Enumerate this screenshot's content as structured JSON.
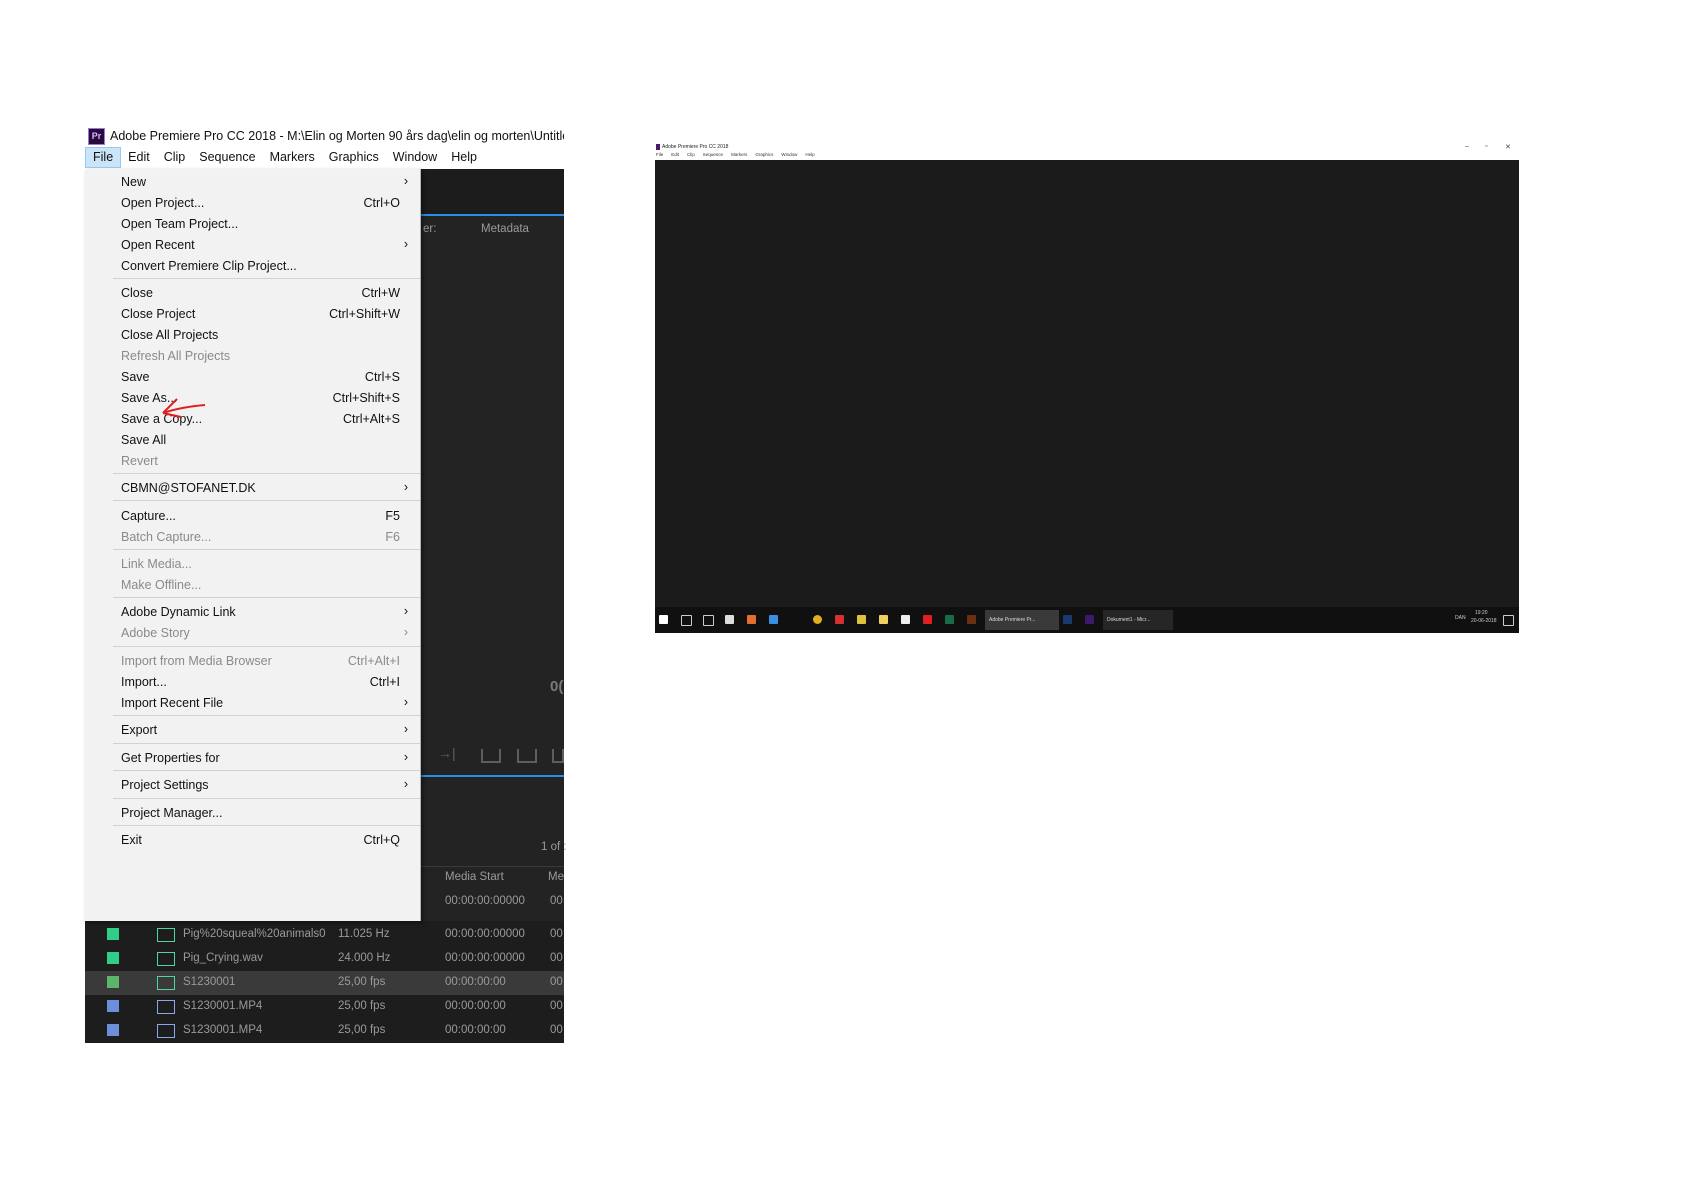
{
  "app": {
    "title": "Adobe Premiere Pro CC 2018 - M:\\Elin og Morten 90 års dag\\elin og morten\\Untitle",
    "logo": "Pr",
    "menubar": [
      "File",
      "Edit",
      "Clip",
      "Sequence",
      "Markers",
      "Graphics",
      "Window",
      "Help"
    ]
  },
  "file_menu": {
    "items": [
      {
        "label": "New",
        "shortcut": "",
        "submenu": true,
        "disabled": false
      },
      {
        "label": "Open Project...",
        "shortcut": "Ctrl+O",
        "submenu": false,
        "disabled": false
      },
      {
        "label": "Open Team Project...",
        "shortcut": "",
        "submenu": false,
        "disabled": false
      },
      {
        "label": "Open Recent",
        "shortcut": "",
        "submenu": true,
        "disabled": false
      },
      {
        "label": "Convert Premiere Clip Project...",
        "shortcut": "",
        "submenu": false,
        "disabled": false
      },
      {
        "label": "Close",
        "shortcut": "Ctrl+W",
        "submenu": false,
        "disabled": false
      },
      {
        "label": "Close Project",
        "shortcut": "Ctrl+Shift+W",
        "submenu": false,
        "disabled": false
      },
      {
        "label": "Close All Projects",
        "shortcut": "",
        "submenu": false,
        "disabled": false
      },
      {
        "label": "Refresh All Projects",
        "shortcut": "",
        "submenu": false,
        "disabled": true
      },
      {
        "label": "Save",
        "shortcut": "Ctrl+S",
        "submenu": false,
        "disabled": false
      },
      {
        "label": "Save As...",
        "shortcut": "Ctrl+Shift+S",
        "submenu": false,
        "disabled": false
      },
      {
        "label": "Save a Copy...",
        "shortcut": "Ctrl+Alt+S",
        "submenu": false,
        "disabled": false
      },
      {
        "label": "Save All",
        "shortcut": "",
        "submenu": false,
        "disabled": false
      },
      {
        "label": "Revert",
        "shortcut": "",
        "submenu": false,
        "disabled": true
      },
      {
        "label": "CBMN@STOFANET.DK",
        "shortcut": "",
        "submenu": true,
        "disabled": false
      },
      {
        "label": "Capture...",
        "shortcut": "F5",
        "submenu": false,
        "disabled": false
      },
      {
        "label": "Batch Capture...",
        "shortcut": "F6",
        "submenu": false,
        "disabled": true
      },
      {
        "label": "Link Media...",
        "shortcut": "",
        "submenu": false,
        "disabled": true
      },
      {
        "label": "Make Offline...",
        "shortcut": "",
        "submenu": false,
        "disabled": true
      },
      {
        "label": "Adobe Dynamic Link",
        "shortcut": "",
        "submenu": true,
        "disabled": false
      },
      {
        "label": "Adobe Story",
        "shortcut": "",
        "submenu": true,
        "disabled": true
      },
      {
        "label": "Import from Media Browser",
        "shortcut": "Ctrl+Alt+I",
        "submenu": false,
        "disabled": true
      },
      {
        "label": "Import...",
        "shortcut": "Ctrl+I",
        "submenu": false,
        "disabled": false
      },
      {
        "label": "Import Recent File",
        "shortcut": "",
        "submenu": true,
        "disabled": false
      },
      {
        "label": "Export",
        "shortcut": "",
        "submenu": true,
        "disabled": false
      },
      {
        "label": "Get Properties for",
        "shortcut": "",
        "submenu": true,
        "disabled": false
      },
      {
        "label": "Project Settings",
        "shortcut": "",
        "submenu": true,
        "disabled": false
      },
      {
        "label": "Project Manager...",
        "shortcut": "",
        "submenu": false,
        "disabled": false
      },
      {
        "label": "Exit",
        "shortcut": "Ctrl+Q",
        "submenu": false,
        "disabled": false
      }
    ]
  },
  "background_panel": {
    "panel_text_left": "er:",
    "metadata_tab": "Metadata",
    "timecode_fragment": "0(",
    "page_count": "1 of :",
    "col_media_start": "Media Start",
    "col_more": "Me",
    "first_row_start": "00:00:00:00000",
    "first_row_more": "00"
  },
  "files": [
    {
      "name": "Pig%20squeal%20animals0",
      "rate": "11.025 Hz",
      "start": "00:00:00:00000",
      "more": "00",
      "color": "#2fcf8a",
      "kind": "audio",
      "selected": false
    },
    {
      "name": "Pig_Crying.wav",
      "rate": "24.000 Hz",
      "start": "00:00:00:00000",
      "more": "00",
      "color": "#2fcf8a",
      "kind": "audio",
      "selected": false
    },
    {
      "name": "S1230001",
      "rate": "25,00 fps",
      "start": "00:00:00:00",
      "more": "00",
      "color": "#5bb56b",
      "kind": "sequence",
      "selected": true
    },
    {
      "name": "S1230001.MP4",
      "rate": "25,00 fps",
      "start": "00:00:00:00",
      "more": "00",
      "color": "#6b8fd8",
      "kind": "video",
      "selected": false
    },
    {
      "name": "S1230001.MP4",
      "rate": "25,00 fps",
      "start": "00:00:00:00",
      "more": "00",
      "color": "#6b8fd8",
      "kind": "video",
      "selected": false
    }
  ],
  "right_window": {
    "title": "Adobe Premiere Pro CC 2018",
    "menu": [
      "File",
      "Edit",
      "Clip",
      "Sequence",
      "Markers",
      "Graphics",
      "Window",
      "Help"
    ],
    "controls": [
      "–",
      "▫",
      "✕"
    ],
    "taskbar": {
      "premiere_task": "Adobe Premiere Pr...",
      "word_task": "Dokument1 - Micr...",
      "tray_lang": "DAN",
      "tray_time": "19:20",
      "tray_date": "20-06-2018"
    }
  },
  "colors": {
    "accent_blue": "#2d8ceb",
    "annotation_red": "#e02020",
    "menu_bg": "#f2f2f2",
    "panel_bg": "#232323"
  }
}
